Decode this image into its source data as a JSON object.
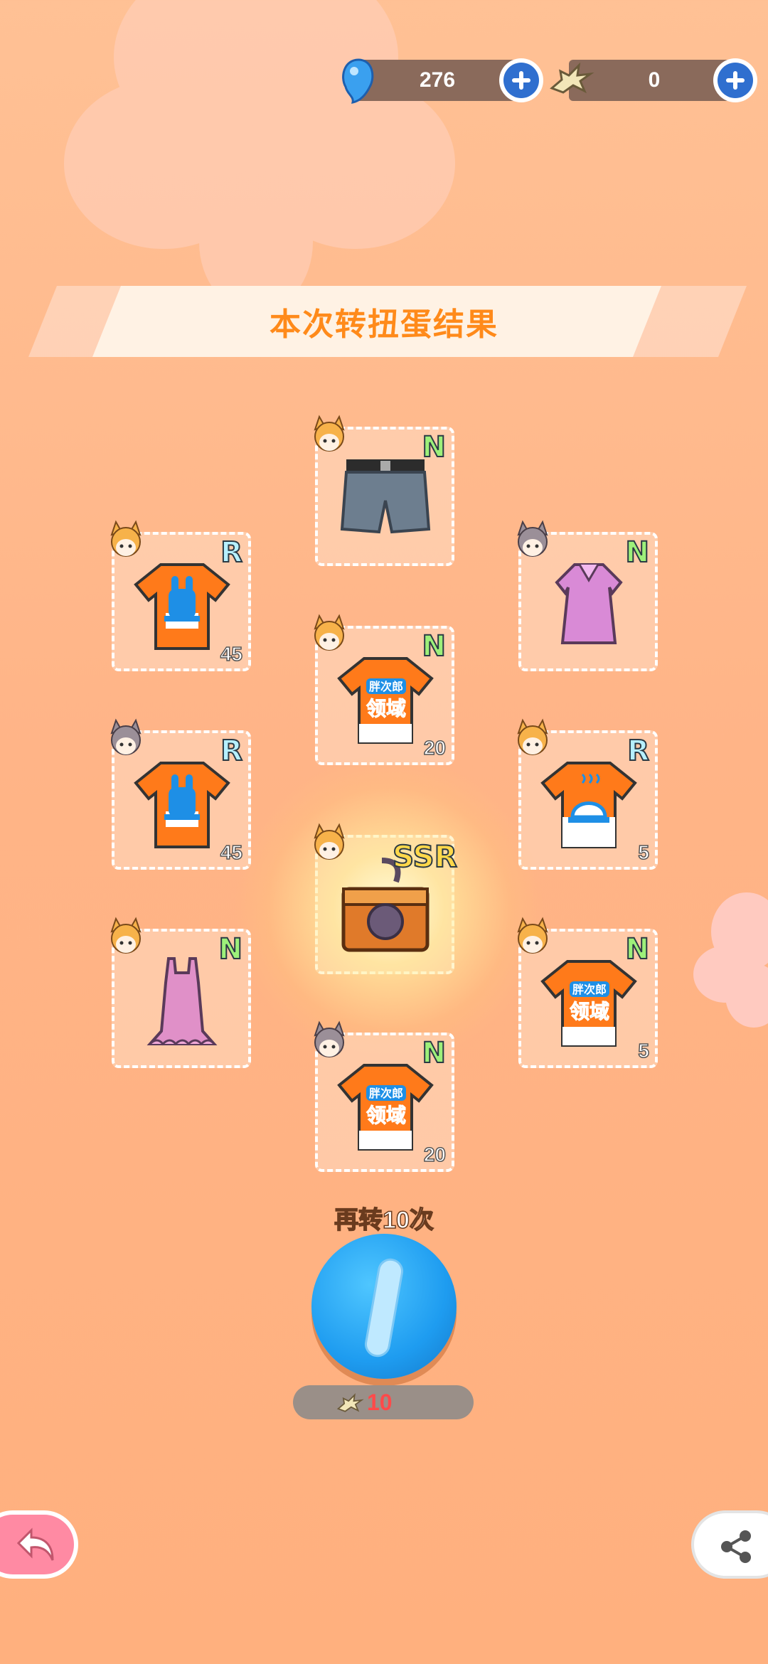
{
  "currency": {
    "gems": {
      "icon": "blue-gem-icon",
      "value": "276"
    },
    "fish": {
      "icon": "fish-bone-ticket-icon",
      "value": "0"
    }
  },
  "banner": {
    "title": "本次转扭蛋结果"
  },
  "results": [
    {
      "id": "shorts",
      "rarity": "N",
      "count": "",
      "item": "jeans-shorts",
      "avatar": "fox-girl-avatar"
    },
    {
      "id": "tshirt-bunny-1",
      "rarity": "R",
      "count": "45",
      "item": "bunny-tshirt",
      "avatar": "fox-girl-avatar"
    },
    {
      "id": "pink-dress",
      "rarity": "N",
      "count": "",
      "item": "pink-shirt-dress",
      "avatar": "gray-cat-avatar"
    },
    {
      "id": "tshirt-text-1",
      "rarity": "N",
      "count": "20",
      "item": "logo-tshirt",
      "avatar": "fox-girl-avatar"
    },
    {
      "id": "tshirt-bunny-2",
      "rarity": "R",
      "count": "45",
      "item": "bunny-tshirt",
      "avatar": "gray-cat-avatar"
    },
    {
      "id": "tshirt-bell",
      "rarity": "R",
      "count": "5",
      "item": "bell-tshirt",
      "avatar": "fox-girl-avatar"
    },
    {
      "id": "chest",
      "rarity": "SSR",
      "count": "",
      "item": "treasure-chest",
      "avatar": "fox-girl-avatar"
    },
    {
      "id": "pink-frill",
      "rarity": "N",
      "count": "",
      "item": "pink-frill-dress",
      "avatar": "fox-girl-avatar"
    },
    {
      "id": "tshirt-text-2",
      "rarity": "N",
      "count": "5",
      "item": "logo-tshirt",
      "avatar": "fox-girl-avatar"
    },
    {
      "id": "tshirt-text-3",
      "rarity": "N",
      "count": "20",
      "item": "logo-tshirt",
      "avatar": "gray-cat-avatar"
    }
  ],
  "tshirt_logo_text": {
    "line1": "胖次郎",
    "line2": "领域"
  },
  "spin": {
    "label": "再转10次",
    "cost": "10",
    "cost_icon": "fish-bone-ticket-icon"
  },
  "colors": {
    "accent": "#ff8a1a",
    "button_blue": "#1e9cf0",
    "cost_red": "#ff4a4a"
  }
}
